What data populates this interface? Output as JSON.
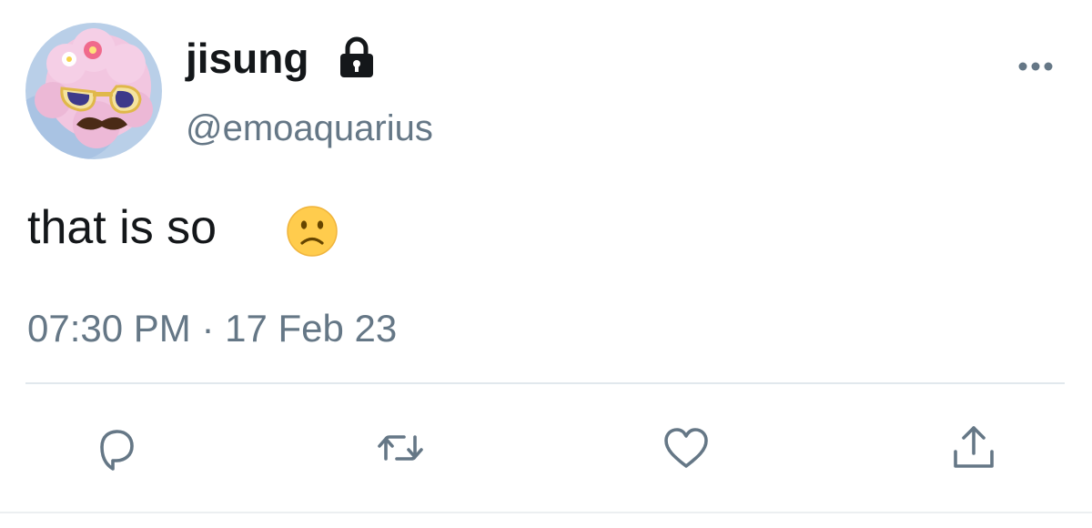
{
  "tweet": {
    "author": {
      "display_name": "jisung",
      "handle": "@emoaquarius"
    },
    "text": "that is so",
    "emoji": "slightly-frowning-face",
    "timestamp": "07:30 PM · 17 Feb 23"
  },
  "icons": {
    "lock": "lock-icon",
    "more": "more-horizontal-icon",
    "reply": "reply-icon",
    "retweet": "retweet-icon",
    "like": "heart-icon",
    "share": "share-icon"
  },
  "colors": {
    "text": "#14171a",
    "secondary": "#657786",
    "divider": "#e1e8ed",
    "emoji": "#ffcc4d"
  }
}
